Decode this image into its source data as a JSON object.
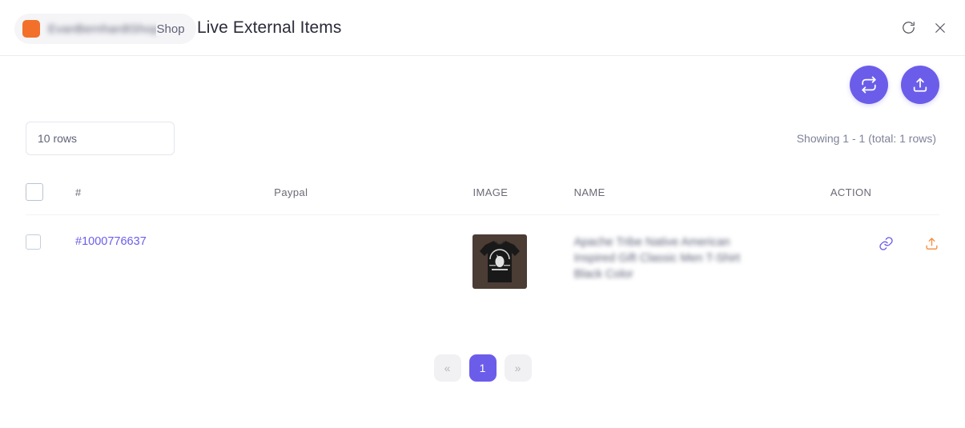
{
  "header": {
    "shop_name": "EvanBernhardtShop",
    "shop_suffix": "Shop",
    "title": "Live External Items",
    "refresh_icon": "refresh-icon",
    "close_icon": "close-icon",
    "logo_color": "#f2702a"
  },
  "toolbar": {
    "sync_button_icon": "sync-repeat-icon",
    "upload_button_icon": "upload-icon",
    "rows_select_value": "10 rows",
    "rows_select_placeholder": "10 rows",
    "showing_text": "Showing 1 - 1 (total: 1 rows)"
  },
  "table": {
    "columns": [
      {
        "key": "check",
        "label": ""
      },
      {
        "key": "id",
        "label": "#"
      },
      {
        "key": "paypal",
        "label": "Paypal"
      },
      {
        "key": "image",
        "label": "IMAGE"
      },
      {
        "key": "name",
        "label": "NAME"
      },
      {
        "key": "action",
        "label": "ACTION"
      }
    ],
    "rows": [
      {
        "id": "#1000776637",
        "paypal": "",
        "image_alt": "black-tshirt-thumbnail",
        "name": "Apache Tribe Native American Inspired Gift Classic Men T-Shirt Black Color",
        "actions": [
          "link-icon",
          "upload-icon"
        ]
      }
    ]
  },
  "pagination": {
    "prev_label": "«",
    "current_page": "1",
    "next_label": "»"
  },
  "colors": {
    "accent_purple": "#6b5dea",
    "accent_orange": "#f68b3c",
    "logo_orange": "#f2702a"
  }
}
